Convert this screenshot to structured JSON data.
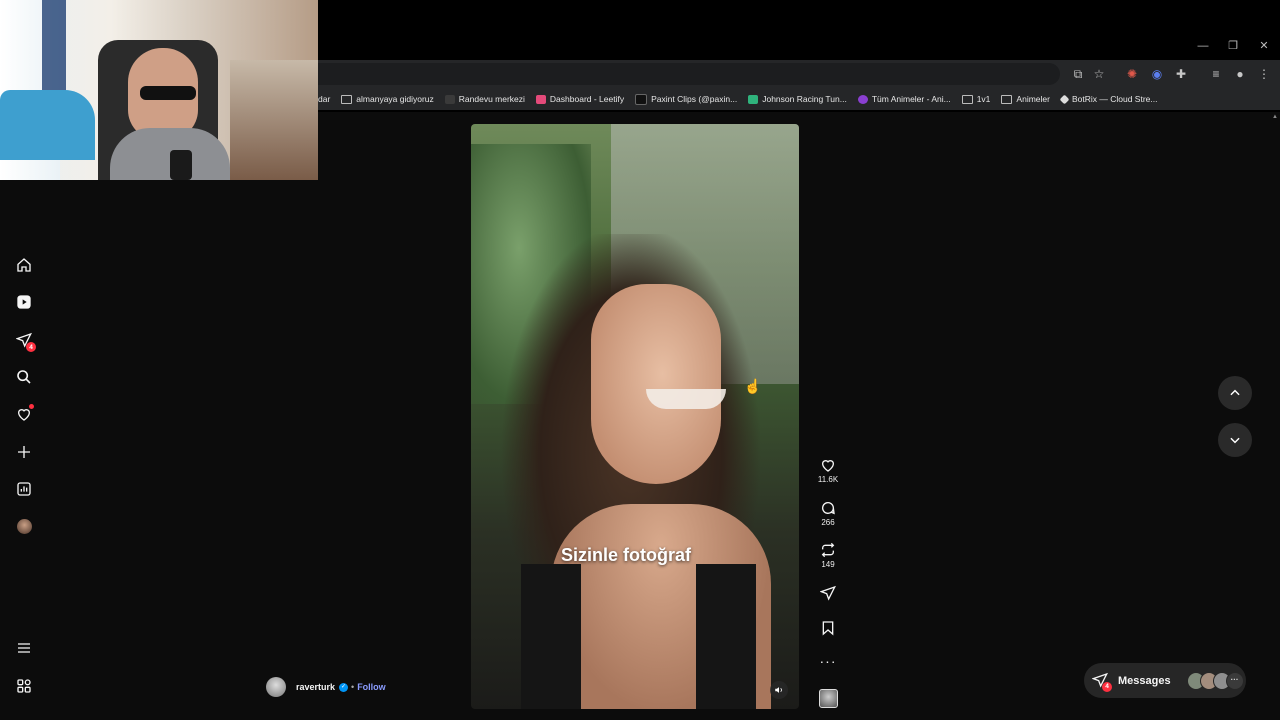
{
  "browser": {
    "bookmarks": [
      {
        "label": "dar",
        "icon": "none"
      },
      {
        "label": "almanyaya gidiyoruz",
        "icon": "folder-icon"
      },
      {
        "label": "Randevu merkezi",
        "icon": "site-icon"
      },
      {
        "label": "Dashboard - Leetify",
        "icon": "leetify-icon"
      },
      {
        "label": "Paxint Clips (@paxin...",
        "icon": "tiktok-icon"
      },
      {
        "label": "Johnson Racing Tun...",
        "icon": "site-icon"
      },
      {
        "label": "Tüm Animeler - Ani...",
        "icon": "site-icon"
      },
      {
        "label": "1v1",
        "icon": "folder-icon"
      },
      {
        "label": "Animeler",
        "icon": "folder-icon"
      },
      {
        "label": "BotRix — Cloud Stre...",
        "icon": "botrix-icon"
      }
    ]
  },
  "sidebar": {
    "messages_badge": "4",
    "notifications_dot": true
  },
  "reel": {
    "subtitle": "Sizinle fotoğraf",
    "author": "raverturk",
    "separator": "•",
    "follow_label": "Follow",
    "likes": "11.6K",
    "comments": "266",
    "reposts": "149"
  },
  "messages": {
    "label": "Messages",
    "badge": "4",
    "more": "···"
  },
  "colors": {
    "accent": "#0095f6",
    "badge": "#ff3040",
    "follow": "#8a9cff"
  }
}
